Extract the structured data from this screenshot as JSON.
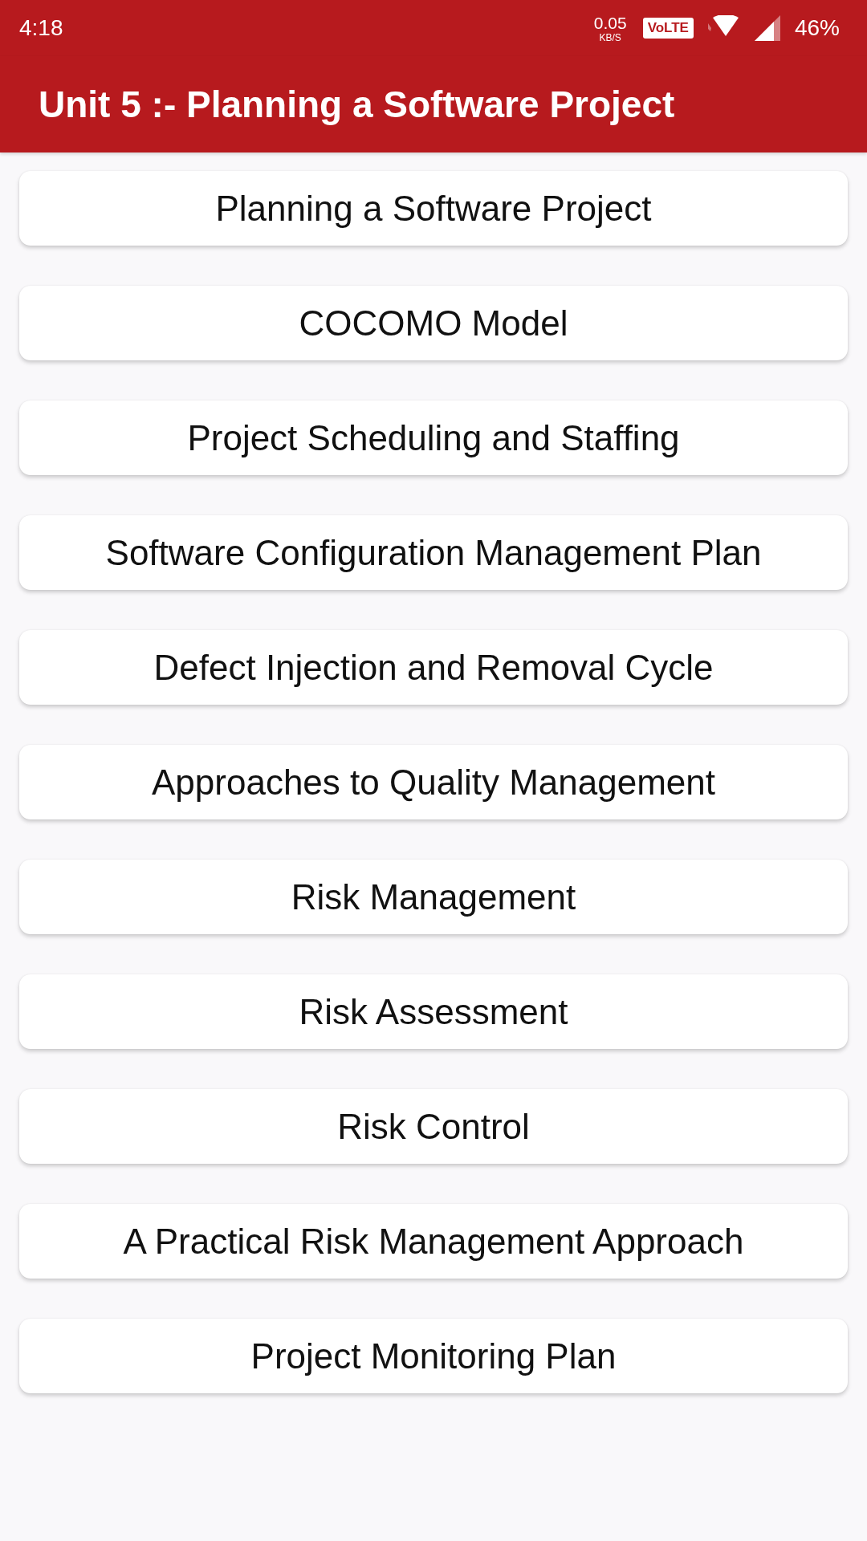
{
  "status_bar": {
    "time": "4:18",
    "net_speed": "0.05",
    "net_unit": "KB/S",
    "volte": "VoLTE",
    "battery": "46%"
  },
  "app_bar": {
    "title": "Unit 5 :- Planning a Software Project"
  },
  "topics": [
    {
      "label": "Planning a Software Project"
    },
    {
      "label": "COCOMO Model"
    },
    {
      "label": "Project Scheduling and Staffing"
    },
    {
      "label": "Software Configuration Management Plan"
    },
    {
      "label": "Defect Injection and Removal Cycle"
    },
    {
      "label": "Approaches to Quality Management"
    },
    {
      "label": "Risk Management"
    },
    {
      "label": "Risk Assessment"
    },
    {
      "label": "Risk Control"
    },
    {
      "label": "A Practical Risk Management Approach"
    },
    {
      "label": "Project Monitoring Plan"
    }
  ]
}
